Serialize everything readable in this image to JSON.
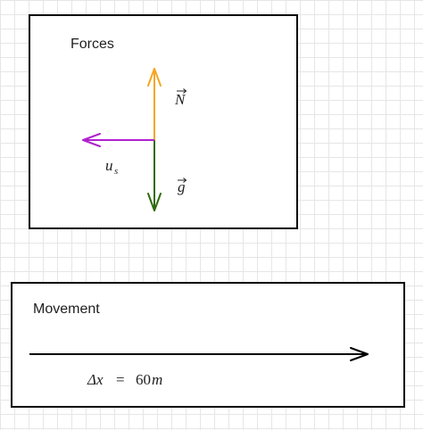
{
  "forces_panel": {
    "title": "Forces",
    "normal_force": {
      "symbol": "N",
      "color": "#f5a623"
    },
    "gravity": {
      "symbol": "g",
      "color": "#2f6b0a"
    },
    "friction": {
      "symbol": "u",
      "subscript": "s",
      "color": "#b020d0"
    }
  },
  "movement_panel": {
    "title": "Movement",
    "displacement": {
      "symbol": "Δx",
      "equals": "=",
      "value": "60",
      "unit": "m"
    },
    "arrow_color": "#000000"
  }
}
